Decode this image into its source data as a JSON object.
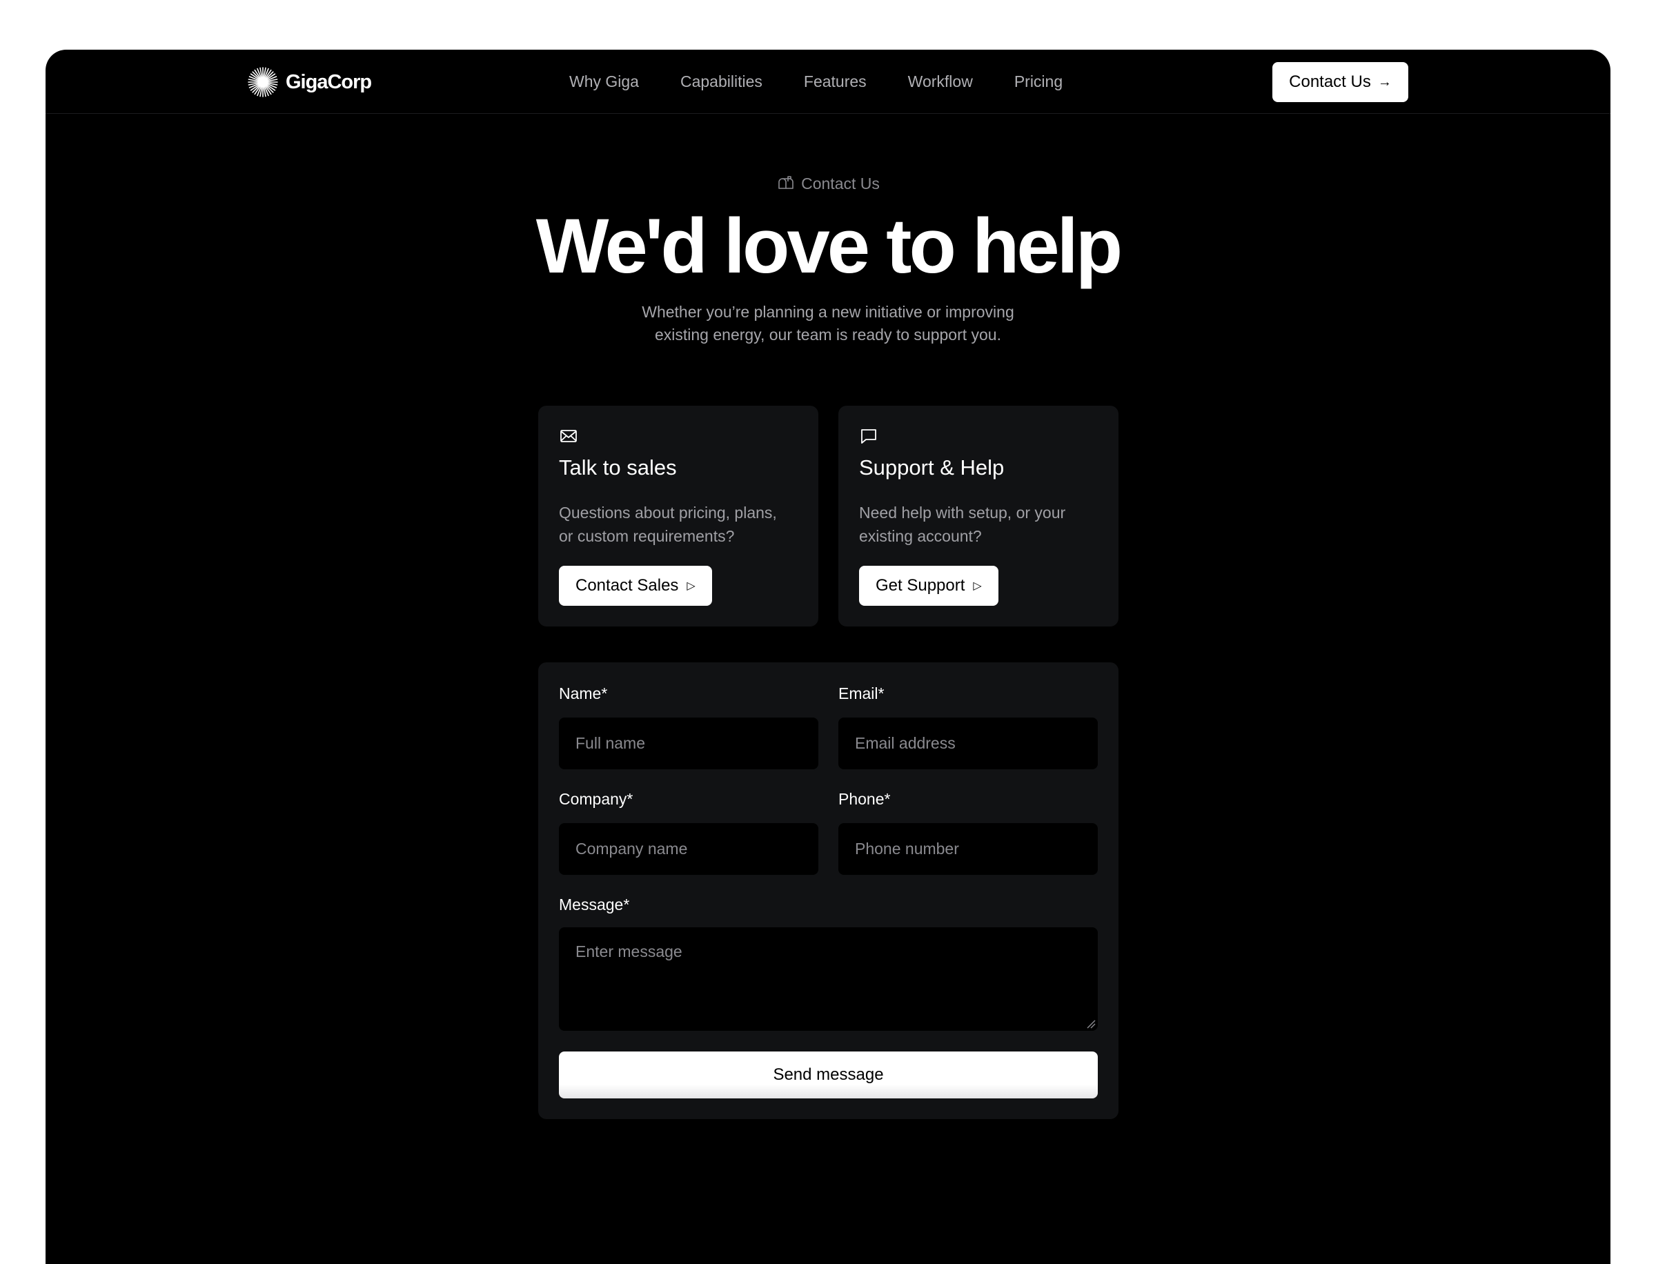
{
  "brand": {
    "name": "GigaCorp",
    "logo_icon": "starburst-icon"
  },
  "nav": {
    "links": [
      "Why Giga",
      "Capabilities",
      "Features",
      "Workflow",
      "Pricing"
    ],
    "cta_label": "Contact Us",
    "cta_icon": "arrow-right-icon"
  },
  "hero": {
    "eyebrow": "Contact Us",
    "eyebrow_icon": "mailbox-icon",
    "title": "We'd love to help",
    "subtitle_line1": "Whether you’re planning a new initiative or improving",
    "subtitle_line2": "existing energy, our team is ready to support you."
  },
  "cards": [
    {
      "icon": "mail-icon",
      "title": "Talk to sales",
      "desc_line1": "Questions about pricing, plans,",
      "desc_line2": "or custom requirements?",
      "button": "Contact Sales"
    },
    {
      "icon": "chat-bubble-icon",
      "title": "Support & Help",
      "desc_line1": "Need help with setup, or your",
      "desc_line2": "existing account?",
      "button": "Get Support"
    }
  ],
  "form": {
    "name": {
      "label": "Name*",
      "placeholder": "Full name",
      "value": ""
    },
    "email": {
      "label": "Email*",
      "placeholder": "Email address",
      "value": ""
    },
    "company": {
      "label": "Company*",
      "placeholder": "Company name",
      "value": ""
    },
    "phone": {
      "label": "Phone*",
      "placeholder": "Phone number",
      "value": ""
    },
    "message": {
      "label": "Message*",
      "placeholder": "Enter message",
      "value": ""
    },
    "submit_label": "Send message"
  },
  "colors": {
    "background": "#000000",
    "surface": "#111214",
    "accent": "#ffffff",
    "muted_text": "#a0a0a5"
  }
}
